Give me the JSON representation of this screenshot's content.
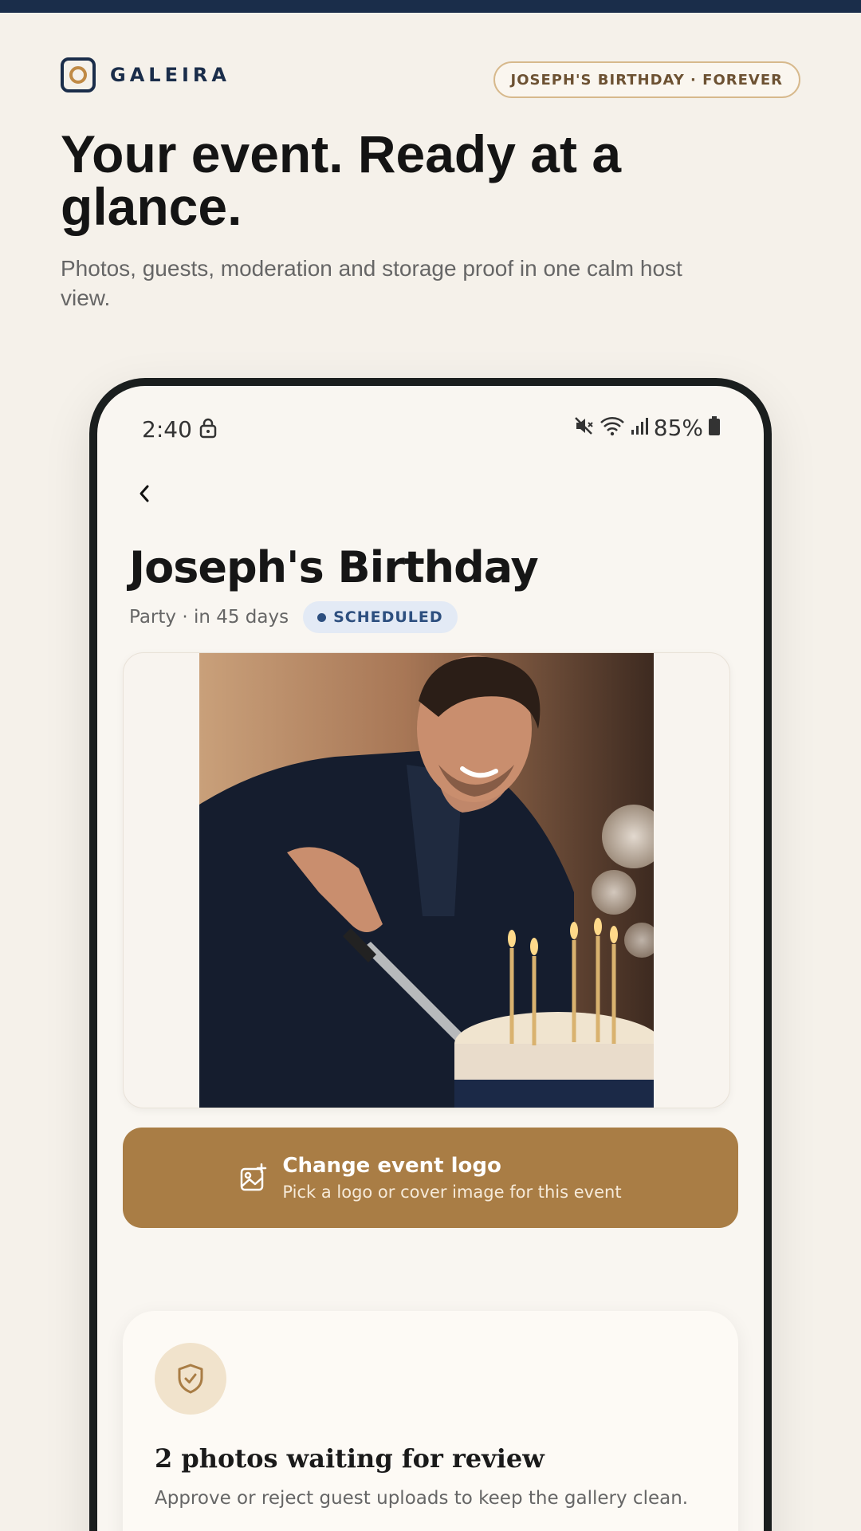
{
  "brand": {
    "name": "GALEIRA"
  },
  "header": {
    "event_pill": "JOSEPH'S BIRTHDAY · FOREVER"
  },
  "hero": {
    "title": "Your event. Ready at a glance.",
    "subtitle": "Photos, guests, moderation and storage proof in one calm host view."
  },
  "phone": {
    "status_bar": {
      "time": "2:40",
      "battery": "85%",
      "icons": [
        "lock-icon",
        "mute-icon",
        "wifi-icon",
        "signal-icon",
        "battery-icon"
      ]
    },
    "event": {
      "title": "Joseph's Birthday",
      "meta": "Party · in 45 days",
      "status": "SCHEDULED"
    },
    "logo_button": {
      "title": "Change event logo",
      "subtitle": "Pick a logo or cover image for this event"
    },
    "review_card": {
      "title": "2 photos waiting for review",
      "subtitle": "Approve or reject guest uploads to keep the gallery clean."
    }
  },
  "colors": {
    "page_bg": "#f5f1ea",
    "navy": "#1a2d4a",
    "accent_gold": "#a97d45",
    "badge_blue": "#2d4f7f"
  }
}
